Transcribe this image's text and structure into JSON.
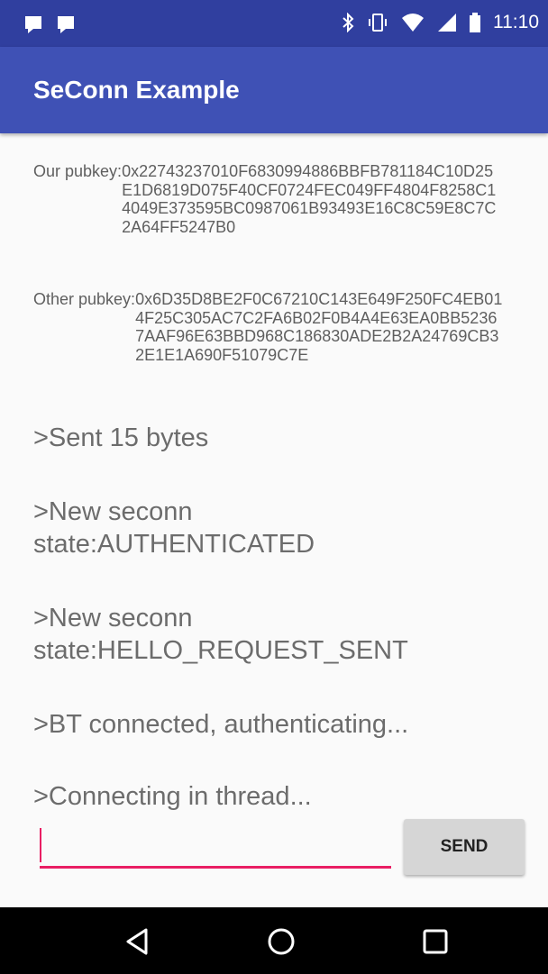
{
  "status_bar": {
    "time": "11:10",
    "icons": [
      "notification-icon",
      "notification-icon",
      "bluetooth-icon",
      "vibrate-icon",
      "wifi-icon",
      "signal-icon",
      "battery-icon"
    ]
  },
  "app_bar": {
    "title": "SeConn Example"
  },
  "keys": {
    "ours_label": "Our pubkey:",
    "ours_value": "0x22743237010F6830994886BBFB781184C10D25E1D6819D075F40CF0724FEC049FF4804F8258C14049E373595BC0987061B93493E16C8C59E8C7C2A64FF5247B0",
    "other_label": "Other pubkey:",
    "other_value": "0x6D35D8BE2F0C67210C143E649F250FC4EB014F25C305AC7C2FA6B02F0B4A4E63EA0BB52367AAF96E63BBD968C186830ADE2B2A24769CB32E1E1A690F51079C7E"
  },
  "log": [
    ">Sent 15 bytes",
    ">New seconn state:AUTHENTICATED",
    ">New seconn state:HELLO_REQUEST_SENT",
    ">BT connected, authenticating...",
    ">Connecting in thread..."
  ],
  "input": {
    "value": "",
    "placeholder": ""
  },
  "send_button": {
    "label": "SEND"
  },
  "colors": {
    "status_bar": "#303f9f",
    "app_bar": "#3f51b5",
    "accent": "#e91e63"
  }
}
